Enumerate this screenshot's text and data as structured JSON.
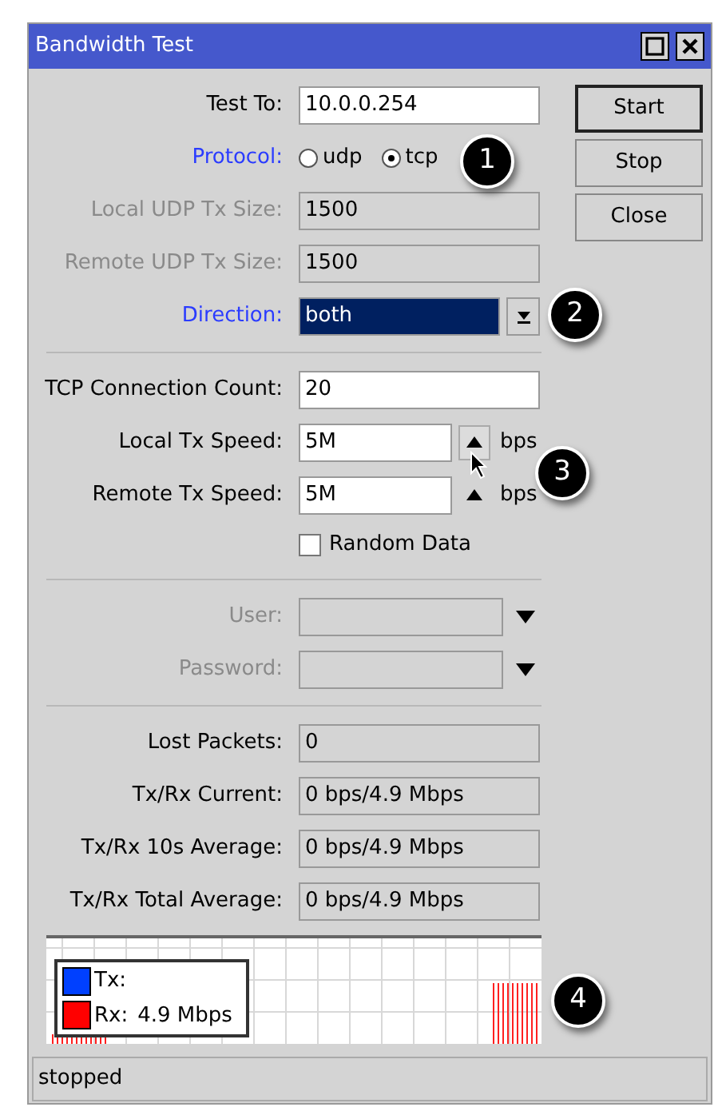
{
  "window": {
    "title": "Bandwidth Test"
  },
  "buttons": [
    {
      "label": "Start",
      "default": true
    },
    {
      "label": "Stop",
      "default": false
    },
    {
      "label": "Close",
      "default": false
    }
  ],
  "sections": [
    [
      {
        "kind": "text",
        "label": "Test To:",
        "value": "10.0.0.254",
        "linked": false,
        "disabled": false
      },
      {
        "kind": "radio",
        "label": "Protocol:",
        "linked": true,
        "disabled": false,
        "options": [
          {
            "label": "udp",
            "selected": false
          },
          {
            "label": "tcp",
            "selected": true
          }
        ]
      },
      {
        "kind": "text",
        "label": "Local UDP Tx Size:",
        "value": "1500",
        "linked": false,
        "disabled": true
      },
      {
        "kind": "text",
        "label": "Remote UDP Tx Size:",
        "value": "1500",
        "linked": false,
        "disabled": true
      },
      {
        "kind": "select",
        "label": "Direction:",
        "value": "both",
        "linked": true,
        "disabled": false
      }
    ],
    [
      {
        "kind": "text",
        "label": "TCP Connection Count:",
        "value": "20",
        "linked": false,
        "disabled": false
      },
      {
        "kind": "spin",
        "label": "Local Tx Speed:",
        "value": "5M",
        "unit": "bps",
        "hovered": true,
        "linked": false,
        "disabled": false
      },
      {
        "kind": "spin",
        "label": "Remote Tx Speed:",
        "value": "5M",
        "unit": "bps",
        "hovered": false,
        "linked": false,
        "disabled": false
      },
      {
        "kind": "checkbox",
        "label": "Random Data",
        "checked": false,
        "linked": false,
        "disabled": false
      }
    ],
    [
      {
        "kind": "combo",
        "label": "User:",
        "linked": false,
        "disabled": true
      },
      {
        "kind": "combo",
        "label": "Password:",
        "linked": false,
        "disabled": true
      }
    ],
    [
      {
        "kind": "readonly",
        "label": "Lost Packets:",
        "value": "0",
        "linked": false,
        "disabled": false
      },
      {
        "kind": "readonly",
        "label": "Tx/Rx Current:",
        "value": "0 bps/4.9 Mbps",
        "linked": false,
        "disabled": false
      },
      {
        "kind": "readonly",
        "label": "Tx/Rx 10s Average:",
        "value": "0 bps/4.9 Mbps",
        "linked": false,
        "disabled": false
      },
      {
        "kind": "readonly",
        "label": "Tx/Rx Total Average:",
        "value": "0 bps/4.9 Mbps",
        "linked": false,
        "disabled": false
      }
    ]
  ],
  "graph": {
    "legend": [
      {
        "label": "Tx:",
        "color": "#0040ff"
      },
      {
        "label": "Rx:",
        "value": "4.9 Mbps",
        "color": "#ff0000"
      }
    ]
  },
  "status_bar": "stopped",
  "callouts": [
    "1",
    "2",
    "3",
    "4"
  ]
}
